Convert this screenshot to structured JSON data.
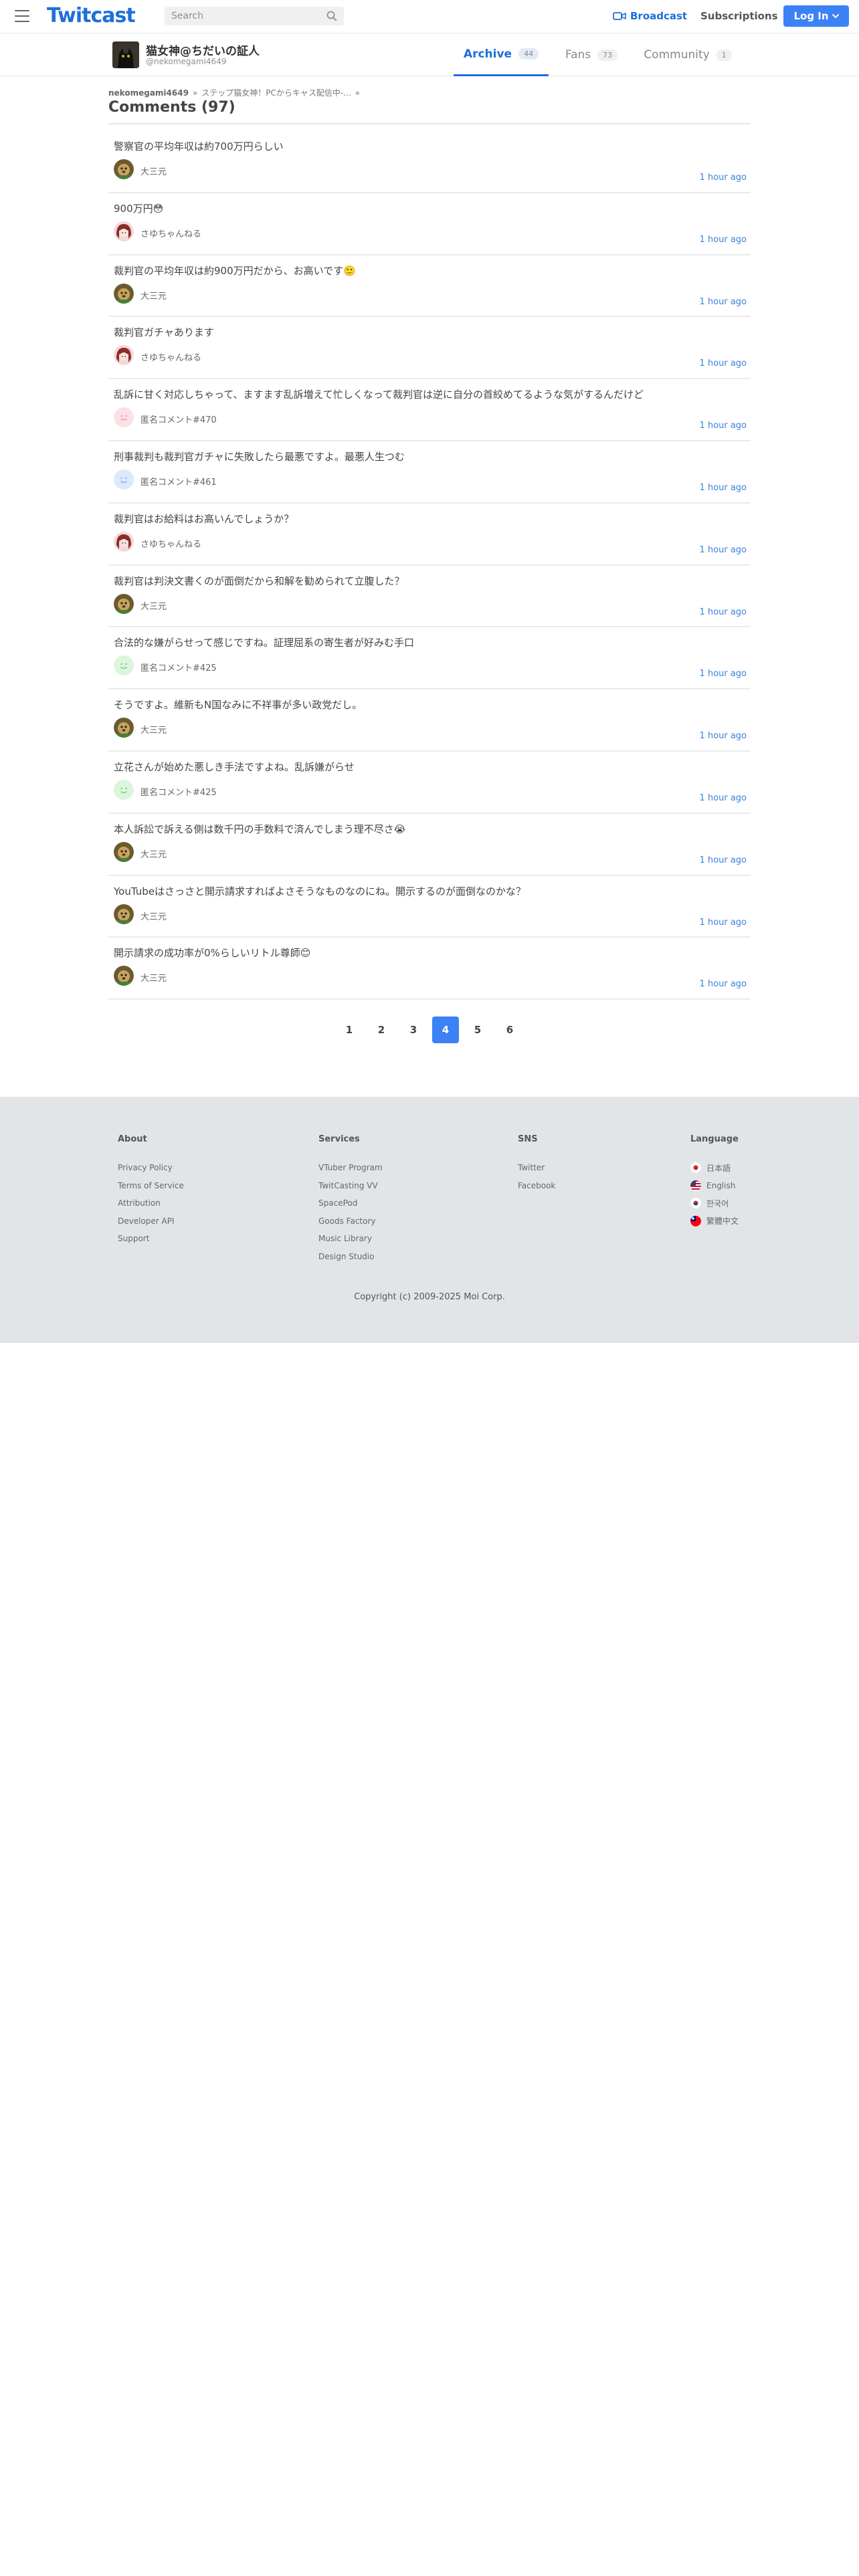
{
  "header": {
    "logo": "Twitcast",
    "search_placeholder": "Search",
    "broadcast_label": "Broadcast",
    "subscriptions_label": "Subscriptions",
    "login_label": "Log In"
  },
  "profile": {
    "name": "猫女神@ちだいの証人",
    "handle": "@nekomegami4649"
  },
  "tabs": [
    {
      "label": "Archive",
      "count": "44"
    },
    {
      "label": "Fans",
      "count": "73"
    },
    {
      "label": "Community",
      "count": "1"
    }
  ],
  "breadcrumb": {
    "user": "nekomegami4649",
    "sep1": "»",
    "stream": "ステップ猫女神！PCからキャス配信中-...",
    "sep2": "»"
  },
  "comments_title": "Comments (97)",
  "comments": [
    {
      "text": "警察官の平均年収は約700万円らしい",
      "user": "大三元",
      "time": "1 hour ago",
      "avatar": "dog"
    },
    {
      "text": "900万円😳",
      "user": "さゆちゃんねる",
      "time": "1 hour ago",
      "avatar": "girl"
    },
    {
      "text": "裁判官の平均年収は約900万円だから、お高いです🙂",
      "user": "大三元",
      "time": "1 hour ago",
      "avatar": "dog"
    },
    {
      "text": "裁判官ガチャあります",
      "user": "さゆちゃんねる",
      "time": "1 hour ago",
      "avatar": "girl"
    },
    {
      "text": "乱訴に甘く対応しちゃって、ますます乱訴増えて忙しくなって裁判官は逆に自分の首絞めてるような気がするんだけど",
      "user": "匿名コメント#470",
      "time": "1 hour ago",
      "avatar": "anon-pink"
    },
    {
      "text": "刑事裁判も裁判官ガチャに失敗したら最悪ですよ。最悪人生つむ",
      "user": "匿名コメント#461",
      "time": "1 hour ago",
      "avatar": "anon-blue"
    },
    {
      "text": "裁判官はお給料はお高いんでしょうか？",
      "user": "さゆちゃんねる",
      "time": "1 hour ago",
      "avatar": "girl"
    },
    {
      "text": "裁判官は判決文書くのが面倒だから和解を勧められて立腹した？",
      "user": "大三元",
      "time": "1 hour ago",
      "avatar": "dog"
    },
    {
      "text": "合法的な嫌がらせって感じですね。証理屈系の寄生者が好みむ手口",
      "user": "匿名コメント#425",
      "time": "1 hour ago",
      "avatar": "anon-green"
    },
    {
      "text": "そうですよ。維新もN国なみに不祥事が多い政党だし。",
      "user": "大三元",
      "time": "1 hour ago",
      "avatar": "dog"
    },
    {
      "text": "立花さんが始めた悪しき手法ですよね。乱訴嫌がらせ",
      "user": "匿名コメント#425",
      "time": "1 hour ago",
      "avatar": "anon-green"
    },
    {
      "text": "本人訴訟で訴える側は数千円の手数料で済んでしまう理不尽さ😭",
      "user": "大三元",
      "time": "1 hour ago",
      "avatar": "dog"
    },
    {
      "text": "YouTubeはさっさと開示請求すればよさそうなものなのにね。開示するのが面倒なのかな？",
      "user": "大三元",
      "time": "1 hour ago",
      "avatar": "dog"
    },
    {
      "text": "開示請求の成功率が0%らしいリトル尊師😊",
      "user": "大三元",
      "time": "1 hour ago",
      "avatar": "dog"
    }
  ],
  "pagination": {
    "pages": [
      "1",
      "2",
      "3",
      "4",
      "5",
      "6"
    ],
    "current": "4"
  },
  "footer": {
    "about": {
      "title": "About",
      "links": [
        "Privacy Policy",
        "Terms of Service",
        "Attribution",
        "Developer API",
        "Support"
      ]
    },
    "services": {
      "title": "Services",
      "links": [
        "VTuber Program",
        "TwitCasting VV",
        "SpacePod",
        "Goods Factory",
        "Music Library",
        "Design Studio"
      ]
    },
    "sns": {
      "title": "SNS",
      "links": [
        "Twitter",
        "Facebook"
      ]
    },
    "language": {
      "title": "Language",
      "links": [
        "日本語",
        "English",
        "한국어",
        "繁體中文"
      ]
    },
    "copyright": "Copyright (c) 2009-2025 Moi Corp."
  },
  "colors": {
    "accent": "#1e6fd9",
    "button": "#3b82f6",
    "time": "#3b82d6",
    "footer_bg": "#e2e5e8"
  }
}
